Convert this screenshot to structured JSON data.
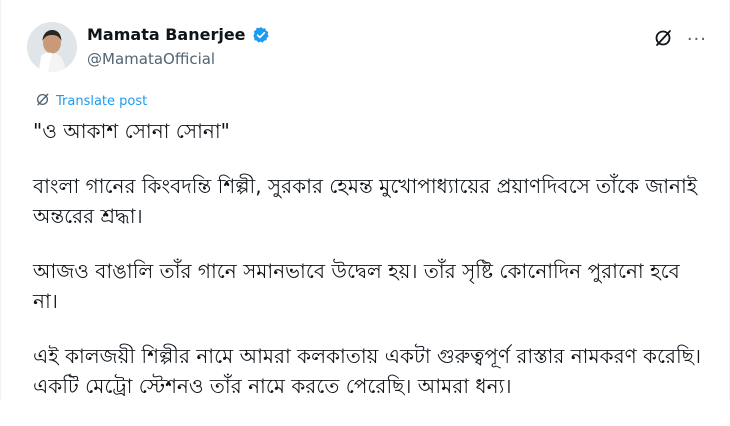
{
  "author": {
    "display_name": "Mamata Banerjee",
    "handle": "@MamataOfficial",
    "verified_icon": "verified-badge-icon"
  },
  "actions": {
    "grok_icon": "grok-slash-circle-icon",
    "more_icon": "more-horizontal-icon",
    "more_label": "···"
  },
  "translate": {
    "label": "Translate post",
    "icon": "grok-slash-circle-icon"
  },
  "post": {
    "title_line": "\"ও আকাশ সোনা সোনা\"",
    "para1": "বাংলা গানের কিংবদন্তি শিল্পী, সুরকার হেমন্ত মুখোপাধ্যায়ের প্রয়াণদিবসে তাঁকে জানাই অন্তরের শ্রদ্ধা।",
    "para2": "আজও বাঙালি তাঁর গানে সমানভাবে উদ্বেল হয়। তাঁর সৃষ্টি কোনোদিন পুরানো হবে না।",
    "para3": "এই কালজয়ী শিল্পীর নামে আমরা কলকাতায় একটা গুরুত্বপূর্ণ রাস্তার নামকরণ করেছি। একটি মেট্রো স্টেশনও তাঁর নামে করতে পেরেছি। আমরা ধন্য।"
  },
  "colors": {
    "accent": "#1d9bf0",
    "text": "#0f1419",
    "muted": "#536471"
  }
}
